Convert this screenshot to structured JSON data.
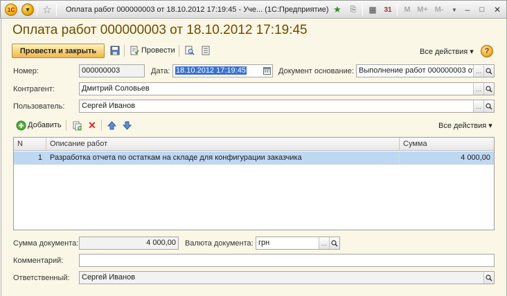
{
  "window": {
    "title": "Оплата работ 000000003 от 18.10.2012 17:19:45 - Уче... (1С:Предприятие)",
    "m_label": "M",
    "m_plus_label": "M+",
    "m_minus_label": "M-"
  },
  "document": {
    "heading": "Оплата работ 000000003 от 18.10.2012 17:19:45"
  },
  "toolbar": {
    "post_close_label": "Провести и закрыть",
    "post_label": "Провести",
    "all_actions_label": "Все действия ▾",
    "help_label": "?"
  },
  "form": {
    "number_label": "Номер:",
    "number_value": "000000003",
    "date_label": "Дата:",
    "date_value": "18.10.2012 17:19:45",
    "basis_label": "Документ основание:",
    "basis_value": "Выполнение работ 000000003 от",
    "contractor_label": "Контрагент:",
    "contractor_value": "Дмитрий Соловьев",
    "user_label": "Пользователь:",
    "user_value": "Сергей Иванов"
  },
  "table_toolbar": {
    "add_label": "Добавить",
    "all_actions_label": "Все действия ▾"
  },
  "table": {
    "columns": [
      "N",
      "Описание работ",
      "Сумма"
    ],
    "rows": [
      {
        "n": "1",
        "description": "Разработка отчета по остаткам на складе для конфигурации заказчика",
        "amount": "4 000,00"
      }
    ]
  },
  "footer": {
    "sum_label": "Сумма документа:",
    "sum_value": "4 000,00",
    "currency_label": "Валюта документа:",
    "currency_value": "грн",
    "comment_label": "Комментарий:",
    "comment_value": "",
    "responsible_label": "Ответственный:",
    "responsible_value": "Сергей Иванов"
  },
  "colors": {
    "accent": "#6b4c00",
    "selection": "#3a6fd6",
    "row_highlight": "#bfd8f2",
    "frame_bg": "#fbf7e6"
  }
}
